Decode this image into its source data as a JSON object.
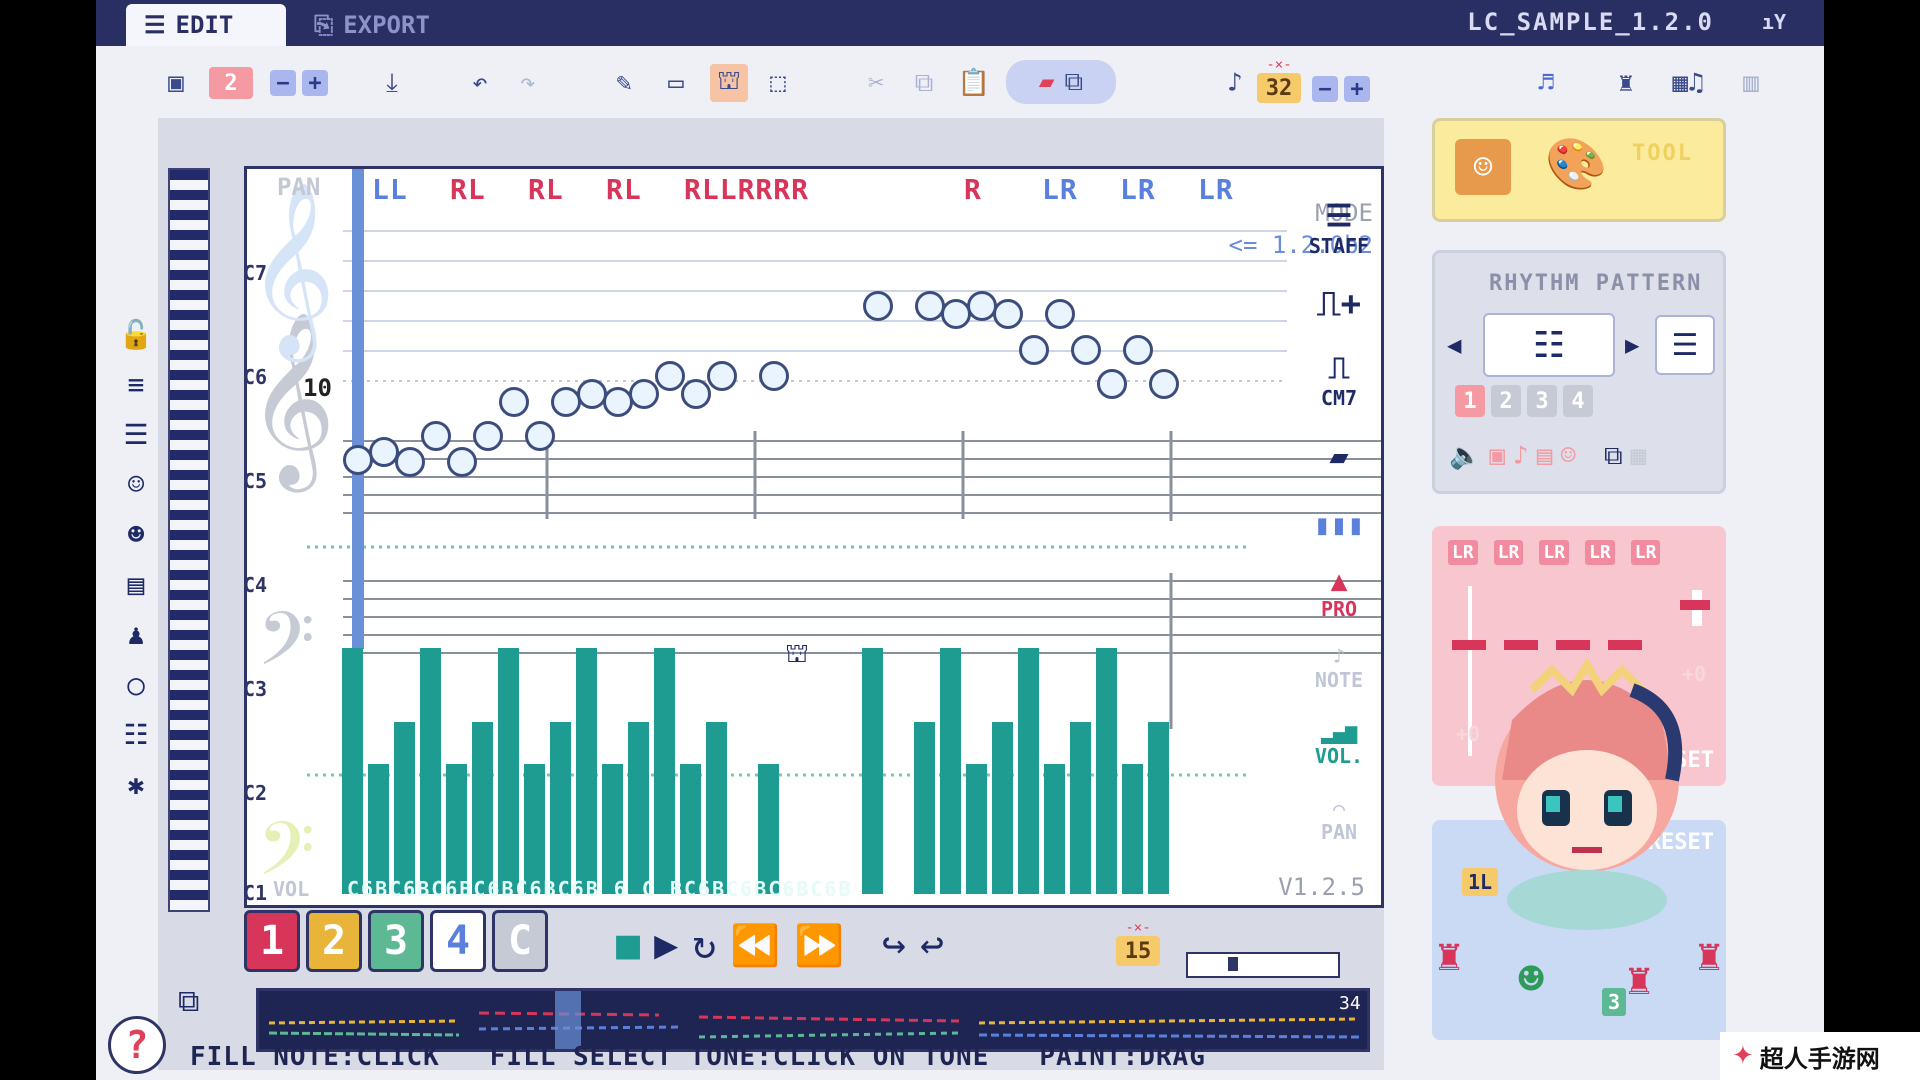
{
  "tabs": {
    "edit": "EDIT",
    "export": "EXPORT"
  },
  "project_title": "LC_SAMPLE_1.2.0",
  "toolbar": {
    "slot_number": "2",
    "step_value": "32"
  },
  "editor": {
    "pan_label": "PAN",
    "pan_values": [
      "LL",
      "RL",
      "RL",
      "RL",
      "RLLRRRR",
      "",
      "R",
      "LR",
      "LR",
      "LR"
    ],
    "mode_label": "MODE",
    "mode_version": "<= 1.2.0b2",
    "ruler_number": "10",
    "octaves": [
      "C7",
      "C6",
      "C5",
      "C4",
      "C3",
      "C2",
      "C1"
    ],
    "volume_label": "VOL",
    "note_labels": "C6BC6BC6BC6BC6BC6B 6   C  BC6BC6BC6BC6B",
    "version": "V1.2.5"
  },
  "side_tools": {
    "staff": "STAFF",
    "cm": "CM7",
    "pro": "PRO",
    "note": "NOTE",
    "vol": "VOL.",
    "pan": "PAN"
  },
  "channels": [
    "1",
    "2",
    "3",
    "4",
    "C"
  ],
  "transport": {
    "loop_value": "15",
    "timeline_end": "34"
  },
  "hint_text": "FILL NOTE:CLICK   FILL SELECT TONE:CLICK ON TONE   PAINT:DRAG",
  "panels": {
    "tool": "TOOL",
    "rhythm_title": "RHYTHM PATTERN",
    "rhythm_slots": [
      "1",
      "2",
      "3",
      "4"
    ],
    "mixer_channels": [
      "LR",
      "LR",
      "LR",
      "LR",
      "LR"
    ],
    "mixer_left_value": "+0",
    "mixer_right_value": "+0",
    "mixer_reset": "RESET",
    "lower_reset": "RESET",
    "lower_value": "1L",
    "lower_badge": "3"
  },
  "watermark": "超人手游网",
  "colors": {
    "accent_teal": "#1e9c92",
    "accent_red": "#d7355a",
    "accent_blue": "#6a90d8",
    "navy": "#2a2f63"
  }
}
